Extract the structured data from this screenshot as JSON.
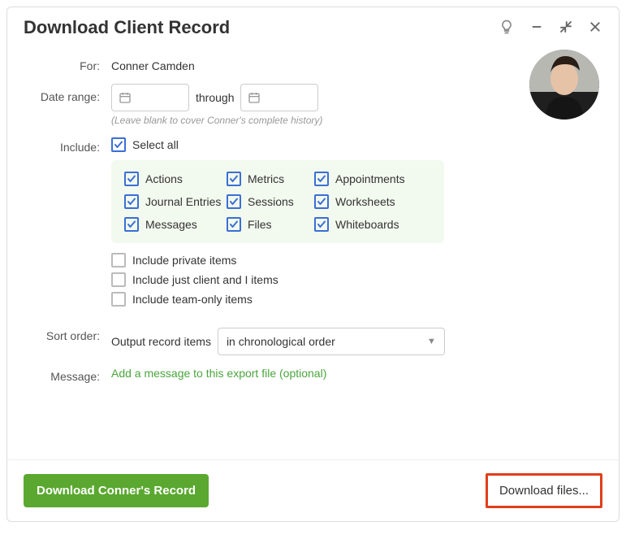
{
  "header": {
    "title": "Download Client Record"
  },
  "client": {
    "for_label": "For:",
    "name": "Conner Camden"
  },
  "date_range": {
    "label": "Date range:",
    "through": "through",
    "hint": "(Leave blank to cover Conner's complete history)"
  },
  "include": {
    "label": "Include:",
    "select_all": "Select all",
    "items": [
      "Actions",
      "Metrics",
      "Appointments",
      "Journal Entries",
      "Sessions",
      "Worksheets",
      "Messages",
      "Files",
      "Whiteboards"
    ],
    "extra": {
      "private": "Include private items",
      "client_and_i": "Include just client and I items",
      "team_only": "Include team-only items"
    }
  },
  "sort": {
    "label": "Sort order:",
    "prefix": "Output record items",
    "selected": "in chronological order"
  },
  "message": {
    "label": "Message:",
    "link": "Add a message to this export file (optional)"
  },
  "footer": {
    "download_record": "Download Conner's Record",
    "download_files": "Download files..."
  }
}
